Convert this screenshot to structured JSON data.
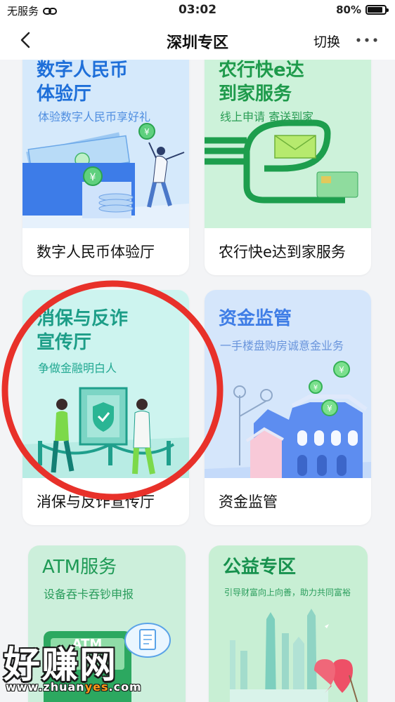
{
  "status_bar": {
    "carrier": "无服务",
    "time": "03:02",
    "battery": "80%"
  },
  "nav": {
    "title": "深圳专区",
    "switch_label": "切换"
  },
  "cards": [
    {
      "hero_title_line1": "数字人民币",
      "hero_title_line2": "体验厅",
      "hero_subtitle": "体验数字人民币享好礼",
      "label": "数字人民币体验厅"
    },
    {
      "hero_title_line1": "农行快e达",
      "hero_title_line2": "到家服务",
      "hero_subtitle": "线上申请 寄送到家",
      "label": "农行快e达到家服务"
    },
    {
      "hero_title_line1": "消保与反诈",
      "hero_title_line2": "宣传厅",
      "hero_subtitle": "争做金融明白人",
      "label": "消保与反诈宣传厅"
    },
    {
      "hero_title_line1": "资金监管",
      "hero_subtitle": "一手楼盘购房诚意金业务",
      "label": "资金监管"
    },
    {
      "hero_title_line1": "ATM服务",
      "hero_subtitle": "设备吞卡吞钞申报",
      "screen_text": "ATM"
    },
    {
      "hero_title_line1": "公益专区",
      "hero_subtitle": "引导财富向上向善，助力共同富裕"
    }
  ],
  "watermark": {
    "brand": "好赚网",
    "url_prefix": "www.zhuan",
    "url_highlight": "yes",
    "url_suffix": ".com"
  },
  "colors": {
    "annotation_circle": "#e8312a",
    "brand_green": "#22b25b"
  }
}
